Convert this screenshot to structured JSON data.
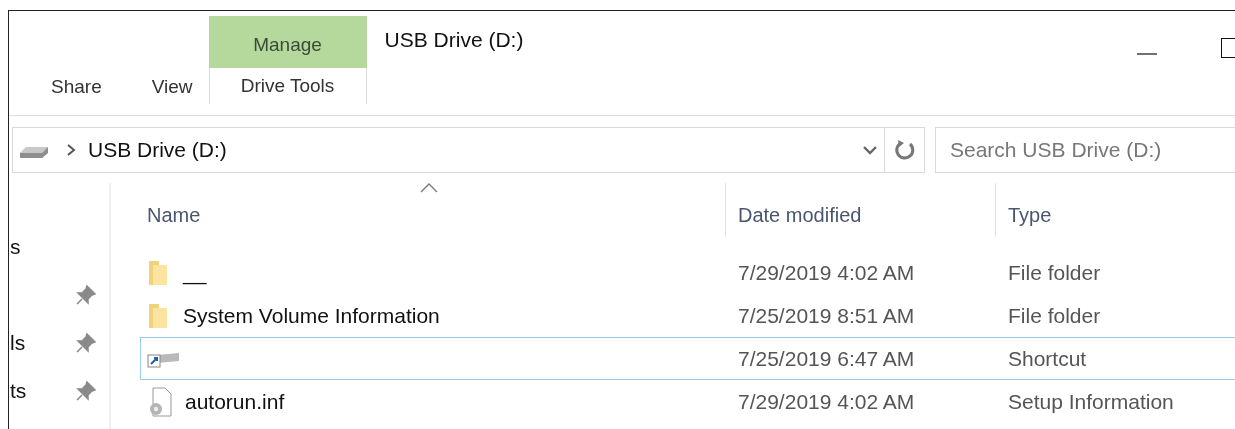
{
  "window": {
    "title": "USB Drive (D:)"
  },
  "ribbon": {
    "tabs": [
      {
        "kind": "plain",
        "label": "Share",
        "selected": false
      },
      {
        "kind": "plain",
        "label": "View",
        "selected": false
      },
      {
        "kind": "contextual",
        "group_label": "Manage",
        "label": "Drive Tools",
        "selected": false
      }
    ]
  },
  "address_bar": {
    "path": [
      "USB Drive (D:)"
    ]
  },
  "search": {
    "placeholder": "Search USB Drive (D:)"
  },
  "nav_pane": {
    "items": [
      {
        "label": "s",
        "pinned": false
      },
      {
        "pinned": true
      },
      {
        "label": "ls",
        "pinned": true
      },
      {
        "label": "ts",
        "pinned": true
      }
    ]
  },
  "file_list": {
    "columns": [
      {
        "label": "Name",
        "sorted": true
      },
      {
        "label": "Date modified",
        "sorted": false
      },
      {
        "label": "Type",
        "sorted": false
      }
    ],
    "rows": [
      {
        "kind": "folder",
        "name": "__",
        "date": "7/29/2019 4:02 AM",
        "type": "File folder",
        "hovered": false
      },
      {
        "kind": "folder",
        "name": "System Volume Information",
        "date": "7/25/2019 8:51 AM",
        "type": "File folder",
        "hovered": false
      },
      {
        "kind": "shortcut",
        "date": "7/25/2019 6:47 AM",
        "type": "Shortcut",
        "hovered": true
      },
      {
        "kind": "settings-file",
        "name": "autorun.inf",
        "date": "7/29/2019 4:02 AM",
        "type": "Setup Information",
        "hovered": false
      }
    ]
  }
}
